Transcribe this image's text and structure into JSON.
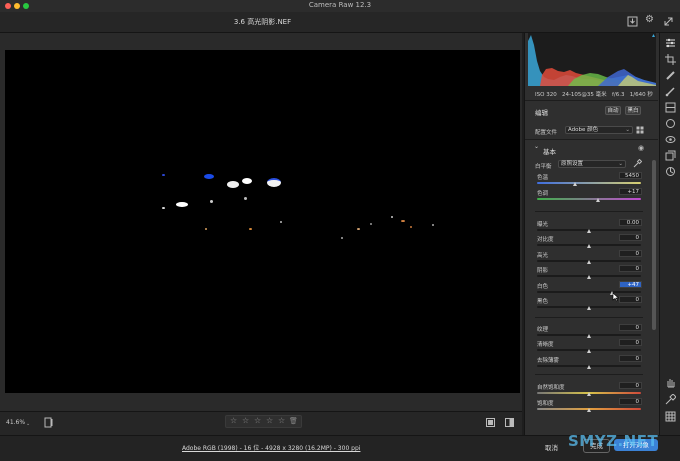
{
  "window": {
    "title": "Camera Raw 12.3"
  },
  "file": {
    "name": "3.6 高光阴影.NEF"
  },
  "camera_info": {
    "iso": "ISO 320",
    "lens": "24-105@35 毫米",
    "aperture": "f/6.3",
    "shutter": "1/640 秒"
  },
  "edit": {
    "title": "编辑",
    "auto_label": "自动",
    "bw_label": "黑白"
  },
  "profile": {
    "label": "配置文件",
    "value": "Adobe 颜色"
  },
  "basic": {
    "title": "基本"
  },
  "white_balance": {
    "label": "白平衡",
    "value": "原照设置"
  },
  "sliders": {
    "temp": {
      "label": "色温",
      "value": "5450",
      "level": 0.37
    },
    "tint": {
      "label": "色调",
      "value": "+17",
      "level": 0.59
    },
    "exposure": {
      "label": "曝光",
      "value": "0.00",
      "level": 0.5
    },
    "contrast": {
      "label": "对比度",
      "value": "0",
      "level": 0.5
    },
    "highlights": {
      "label": "高光",
      "value": "0",
      "level": 0.5
    },
    "shadows": {
      "label": "阴影",
      "value": "0",
      "level": 0.5
    },
    "whites": {
      "label": "白色",
      "value": "+47",
      "level": 0.73
    },
    "blacks": {
      "label": "黑色",
      "value": "0",
      "level": 0.5
    },
    "texture": {
      "label": "纹理",
      "value": "0",
      "level": 0.5
    },
    "clarity": {
      "label": "清晰度",
      "value": "0",
      "level": 0.5
    },
    "dehaze": {
      "label": "去除薄雾",
      "value": "0",
      "level": 0.5
    },
    "vibrance": {
      "label": "自然饱和度",
      "value": "0",
      "level": 0.5
    },
    "saturation": {
      "label": "饱和度",
      "value": "0",
      "level": 0.5
    }
  },
  "bottom": {
    "zoom": "41.6%",
    "stars": [
      "☆",
      "☆",
      "☆",
      "☆",
      "☆"
    ]
  },
  "status": {
    "info": "Adobe RGB (1998) - 16 位 - 4928 x 3280 (16.2MP) - 300 ppi",
    "cancel_label": "取消",
    "done_label": "完成",
    "open_label": "打开对象"
  },
  "watermark": {
    "text": "SMYZ.NET"
  },
  "colors": {
    "accent": "#3b82d6",
    "panel": "#2f2f2f",
    "canvas": "#000000"
  },
  "icons": [
    "download-icon",
    "gear-icon",
    "edit-sliders-icon",
    "crop-icon",
    "healing-icon",
    "brush-icon",
    "gradient-icon",
    "radial-icon",
    "redeye-icon",
    "presets-icon",
    "snapshot-icon",
    "hand-icon",
    "sampler-icon",
    "grid-icon",
    "eyedropper-icon",
    "eye-icon",
    "view-toggle-icon",
    "compare-icon"
  ]
}
